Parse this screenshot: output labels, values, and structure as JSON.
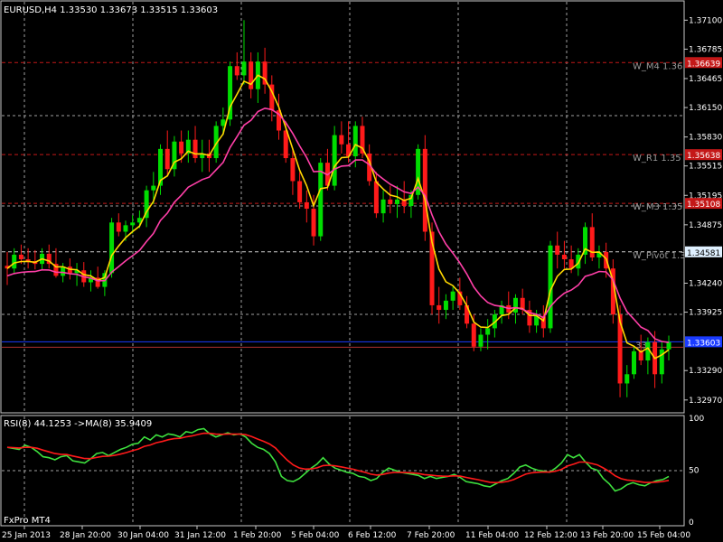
{
  "header": {
    "symbol_info": "EURUSD,H4  1.33530 1.33673 1.33515 1.33603",
    "rsi_info": "RSI(8) 44.1253  ->MA(8) 35.9409",
    "broker": "FxPro MT4"
  },
  "colors": {
    "bull": "#00dd00",
    "bear": "#ff1a1a",
    "ma_fast": "#ffd700",
    "ma_slow": "#ff3fa8",
    "rsi": "#3ee03e",
    "rsi_ma": "#ff1a1a",
    "grid": "#c8c8c8",
    "level": "#c41818",
    "pivot": "#d0d0d0",
    "current": "#1a3bff",
    "frame": "#c8c8c8"
  },
  "axis": {
    "price_ticks": [
      "1.37100",
      "1.36785",
      "1.36465",
      "1.36150",
      "1.35830",
      "1.35515",
      "1.35195",
      "1.34875",
      "1.34240",
      "1.33925",
      "1.33290",
      "1.32970"
    ],
    "rsi_ticks": [
      "100",
      "50",
      "0"
    ],
    "time_labels": [
      "25 Jan 2013",
      "28 Jan 20:00",
      "30 Jan 04:00",
      "31 Jan 12:00",
      "1 Feb 20:00",
      "5 Feb 04:00",
      "6 Feb 12:00",
      "7 Feb 20:00",
      "11 Feb 04:00",
      "12 Feb 12:00",
      "13 Feb 20:00",
      "15 Feb 04:00"
    ]
  },
  "levels": [
    {
      "name": "W_M4 1.36",
      "badge": "1.36639",
      "price": 1.36639,
      "kind": "resistance"
    },
    {
      "name": "W_R1 1.35",
      "badge": "1.35638",
      "price": 1.35638,
      "kind": "resistance"
    },
    {
      "name": "W_M3 1.35",
      "badge": "1.35108",
      "price": 1.35108,
      "kind": "resistance"
    },
    {
      "name": "W_Pivot 1.3",
      "badge": "1.34581",
      "price": 1.34581,
      "kind": "pivot"
    },
    {
      "name": ".33",
      "badge": "1.33603",
      "price": 1.33603,
      "kind": "current"
    }
  ],
  "chart_data": {
    "type": "candlestick",
    "symbol": "EURUSD",
    "timeframe": "H4",
    "y_range": [
      1.3286,
      1.3728
    ],
    "candles": [
      [
        1.3443,
        1.3458,
        1.3422,
        1.344
      ],
      [
        1.344,
        1.3462,
        1.3434,
        1.3455
      ],
      [
        1.3455,
        1.3466,
        1.3445,
        1.345
      ],
      [
        1.345,
        1.3462,
        1.344,
        1.3448
      ],
      [
        1.3448,
        1.346,
        1.3439,
        1.3445
      ],
      [
        1.3445,
        1.3462,
        1.3438,
        1.3456
      ],
      [
        1.3456,
        1.3466,
        1.344,
        1.3445
      ],
      [
        1.3445,
        1.3462,
        1.343,
        1.3432
      ],
      [
        1.3432,
        1.3446,
        1.3425,
        1.3442
      ],
      [
        1.3442,
        1.3451,
        1.3428,
        1.3435
      ],
      [
        1.3435,
        1.3446,
        1.3421,
        1.3438
      ],
      [
        1.3438,
        1.3447,
        1.342,
        1.3425
      ],
      [
        1.3425,
        1.3438,
        1.3415,
        1.343
      ],
      [
        1.343,
        1.3442,
        1.3418,
        1.342
      ],
      [
        1.342,
        1.3438,
        1.341,
        1.3435
      ],
      [
        1.3435,
        1.3495,
        1.343,
        1.349
      ],
      [
        1.349,
        1.35,
        1.3475,
        1.348
      ],
      [
        1.348,
        1.3492,
        1.347,
        1.3487
      ],
      [
        1.3487,
        1.3498,
        1.3478,
        1.349
      ],
      [
        1.349,
        1.3503,
        1.3484,
        1.3495
      ],
      [
        1.3495,
        1.353,
        1.3485,
        1.3525
      ],
      [
        1.3525,
        1.3545,
        1.351,
        1.353
      ],
      [
        1.353,
        1.3575,
        1.352,
        1.357
      ],
      [
        1.357,
        1.359,
        1.354,
        1.3548
      ],
      [
        1.3548,
        1.3584,
        1.354,
        1.3578
      ],
      [
        1.3578,
        1.359,
        1.3555,
        1.3565
      ],
      [
        1.3565,
        1.359,
        1.3555,
        1.358
      ],
      [
        1.358,
        1.3595,
        1.3555,
        1.356
      ],
      [
        1.356,
        1.358,
        1.3545,
        1.3565
      ],
      [
        1.3565,
        1.358,
        1.3545,
        1.356
      ],
      [
        1.356,
        1.36,
        1.3555,
        1.3595
      ],
      [
        1.3595,
        1.3615,
        1.3585,
        1.3602
      ],
      [
        1.3602,
        1.3665,
        1.3595,
        1.366
      ],
      [
        1.366,
        1.3675,
        1.3645,
        1.365
      ],
      [
        1.365,
        1.371,
        1.364,
        1.3665
      ],
      [
        1.3665,
        1.3675,
        1.3625,
        1.3635
      ],
      [
        1.3635,
        1.3675,
        1.362,
        1.3665
      ],
      [
        1.3665,
        1.368,
        1.363,
        1.364
      ],
      [
        1.364,
        1.365,
        1.36,
        1.3612
      ],
      [
        1.3612,
        1.363,
        1.358,
        1.359
      ],
      [
        1.359,
        1.36,
        1.3555,
        1.356
      ],
      [
        1.356,
        1.357,
        1.352,
        1.3535
      ],
      [
        1.3535,
        1.3545,
        1.3505,
        1.3512
      ],
      [
        1.3512,
        1.3525,
        1.349,
        1.3505
      ],
      [
        1.3505,
        1.352,
        1.3465,
        1.3475
      ],
      [
        1.3475,
        1.356,
        1.347,
        1.3555
      ],
      [
        1.3555,
        1.357,
        1.3525,
        1.353
      ],
      [
        1.353,
        1.3595,
        1.3525,
        1.3585
      ],
      [
        1.3585,
        1.36,
        1.3565,
        1.3575
      ],
      [
        1.3575,
        1.36,
        1.3555,
        1.3562
      ],
      [
        1.3562,
        1.36,
        1.355,
        1.3595
      ],
      [
        1.3595,
        1.3605,
        1.356,
        1.3565
      ],
      [
        1.3565,
        1.3575,
        1.353,
        1.3535
      ],
      [
        1.3535,
        1.3545,
        1.3495,
        1.35
      ],
      [
        1.35,
        1.3525,
        1.349,
        1.3515
      ],
      [
        1.3515,
        1.353,
        1.35,
        1.351
      ],
      [
        1.351,
        1.353,
        1.3495,
        1.3515
      ],
      [
        1.3515,
        1.3535,
        1.35,
        1.3508
      ],
      [
        1.3508,
        1.3525,
        1.3495,
        1.352
      ],
      [
        1.352,
        1.3575,
        1.3515,
        1.357
      ],
      [
        1.357,
        1.3585,
        1.347,
        1.348
      ],
      [
        1.348,
        1.349,
        1.339,
        1.34
      ],
      [
        1.34,
        1.342,
        1.338,
        1.3395
      ],
      [
        1.3395,
        1.3412,
        1.3385,
        1.3405
      ],
      [
        1.3405,
        1.342,
        1.3395,
        1.3415
      ],
      [
        1.3415,
        1.343,
        1.3395,
        1.34
      ],
      [
        1.34,
        1.341,
        1.3375,
        1.338
      ],
      [
        1.338,
        1.339,
        1.335,
        1.3355
      ],
      [
        1.3355,
        1.3375,
        1.335,
        1.3368
      ],
      [
        1.3368,
        1.3385,
        1.3352,
        1.3375
      ],
      [
        1.3375,
        1.3395,
        1.3365,
        1.339
      ],
      [
        1.339,
        1.3405,
        1.338,
        1.34
      ],
      [
        1.34,
        1.3415,
        1.3385,
        1.3392
      ],
      [
        1.3392,
        1.3412,
        1.338,
        1.3408
      ],
      [
        1.3408,
        1.3418,
        1.339,
        1.3395
      ],
      [
        1.3395,
        1.3405,
        1.337,
        1.3378
      ],
      [
        1.3378,
        1.3395,
        1.337,
        1.3388
      ],
      [
        1.3388,
        1.34,
        1.3365,
        1.3375
      ],
      [
        1.3375,
        1.347,
        1.337,
        1.3465
      ],
      [
        1.3465,
        1.348,
        1.344,
        1.3455
      ],
      [
        1.3455,
        1.347,
        1.344,
        1.345
      ],
      [
        1.345,
        1.3465,
        1.3435,
        1.344
      ],
      [
        1.344,
        1.3462,
        1.3432,
        1.3455
      ],
      [
        1.3455,
        1.349,
        1.3445,
        1.3485
      ],
      [
        1.3485,
        1.35,
        1.3448,
        1.3452
      ],
      [
        1.3452,
        1.3465,
        1.344,
        1.3458
      ],
      [
        1.3458,
        1.3468,
        1.343,
        1.344
      ],
      [
        1.344,
        1.345,
        1.338,
        1.339
      ],
      [
        1.339,
        1.34,
        1.33,
        1.3315
      ],
      [
        1.3315,
        1.3335,
        1.33,
        1.3325
      ],
      [
        1.3325,
        1.3355,
        1.332,
        1.335
      ],
      [
        1.335,
        1.3368,
        1.3335,
        1.334
      ],
      [
        1.334,
        1.3365,
        1.3325,
        1.336
      ],
      [
        1.336,
        1.3372,
        1.331,
        1.3325
      ],
      [
        1.3325,
        1.336,
        1.3315,
        1.3352
      ],
      [
        1.3352,
        1.3367,
        1.334,
        1.336
      ]
    ],
    "ma_fast": {
      "period": "fast"
    },
    "ma_slow": {
      "period": "slow"
    },
    "rsi": [
      72,
      71,
      70,
      74,
      72,
      68,
      63,
      62,
      60,
      63,
      64,
      59,
      58,
      57,
      61,
      66,
      67,
      64,
      67,
      70,
      72,
      75,
      76,
      82,
      79,
      84,
      82,
      85,
      84,
      82,
      87,
      86,
      89,
      90,
      85,
      82,
      84,
      86,
      84,
      85,
      82,
      76,
      72,
      70,
      66,
      58,
      44,
      40,
      39,
      42,
      47,
      52,
      56,
      62,
      56,
      52,
      50,
      48,
      47,
      44,
      43,
      40,
      42,
      48,
      52,
      50,
      48,
      47,
      46,
      45,
      42,
      44,
      42,
      43,
      44,
      46,
      43,
      39,
      38,
      37,
      35,
      34,
      37,
      40,
      42,
      47,
      53,
      55,
      52,
      50,
      49,
      48,
      52,
      57,
      65,
      62,
      65,
      58,
      52,
      50,
      42,
      37,
      30,
      32,
      36,
      38,
      36,
      35,
      38,
      40,
      41,
      44
    ]
  }
}
